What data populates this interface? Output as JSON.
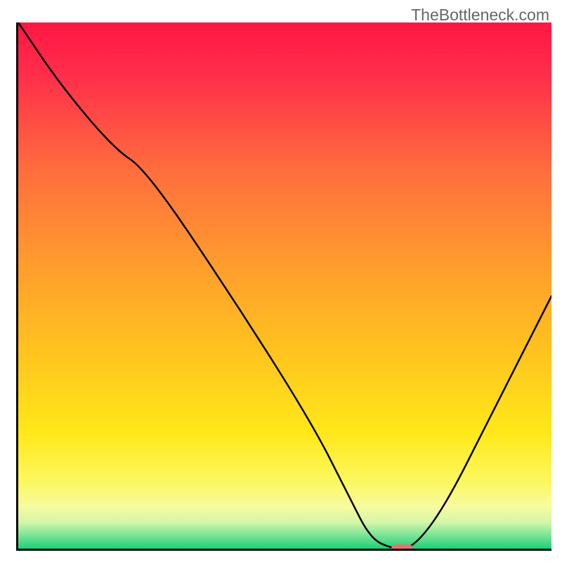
{
  "watermark": "TheBottleneck.com",
  "colors": {
    "marker": "#e57373",
    "axis": "#000000"
  },
  "chart_data": {
    "type": "line",
    "title": "",
    "xlabel": "",
    "ylabel": "",
    "xlim": [
      0,
      100
    ],
    "ylim": [
      0,
      100
    ],
    "x": [
      0,
      8,
      18,
      24,
      40,
      55,
      62,
      66,
      70,
      74,
      80,
      88,
      100
    ],
    "y": [
      100,
      88,
      76,
      72,
      48,
      24,
      10,
      2,
      0,
      0,
      8,
      24,
      48
    ],
    "optimal_marker": {
      "x": 72,
      "y": 0,
      "w": 4,
      "h": 1.6
    },
    "annotations": []
  }
}
